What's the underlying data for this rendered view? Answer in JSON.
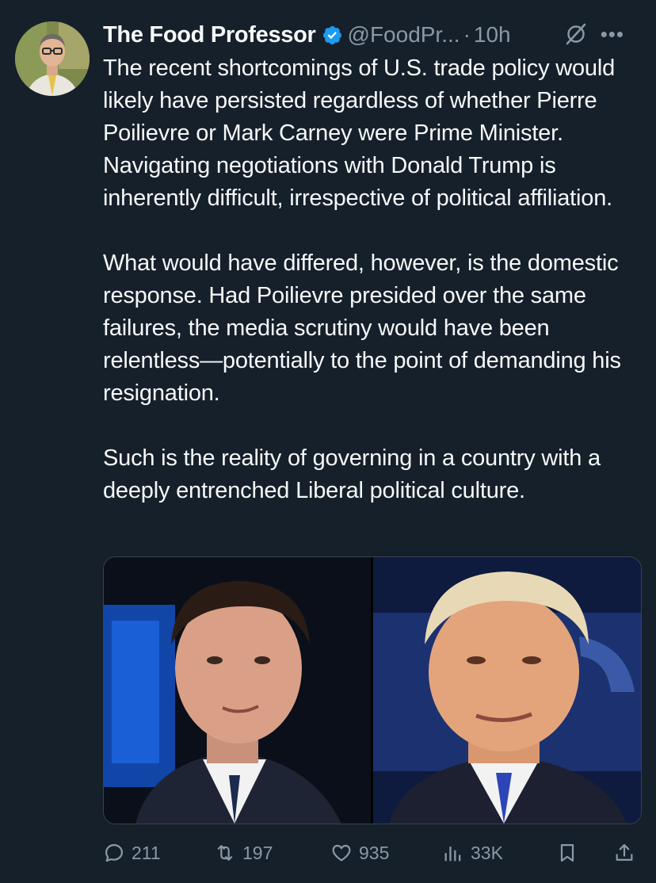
{
  "author": {
    "display_name": "The Food Professor",
    "handle": "@FoodPr...",
    "separator": "·",
    "timestamp": "10h",
    "verified": true,
    "verified_color": "#1d9bf0"
  },
  "tweet": {
    "paragraphs": [
      "The recent shortcomings of U.S. trade policy would likely have persisted regardless of whether Pierre Poilievre or Mark Carney were Prime Minister. Navigating negotiations with Donald Trump is inherently difficult, irrespective of political affiliation.",
      "What would have differed, however, is the domestic response. Had Poilievre presided over the same failures, the media scrutiny would have been relentless—potentially to the point of demanding his resignation.",
      "Such is the reality of governing in a country with a deeply entrenched Liberal political culture."
    ]
  },
  "media": {
    "photos": [
      {
        "description_icon": "person-photo"
      },
      {
        "description_icon": "person-photo"
      }
    ]
  },
  "actions": {
    "replies": "211",
    "reposts": "197",
    "likes": "935",
    "views": "33K"
  },
  "icons": {
    "reply": "reply-icon",
    "repost": "repost-icon",
    "like": "heart-icon",
    "views": "views-icon",
    "bookmark": "bookmark-icon",
    "share": "share-icon",
    "grok": "grok-icon",
    "more": "more-icon"
  },
  "colors": {
    "background": "#15202b",
    "text": "#f7f9f9",
    "secondary": "#8b98a5",
    "accent": "#1d9bf0"
  }
}
